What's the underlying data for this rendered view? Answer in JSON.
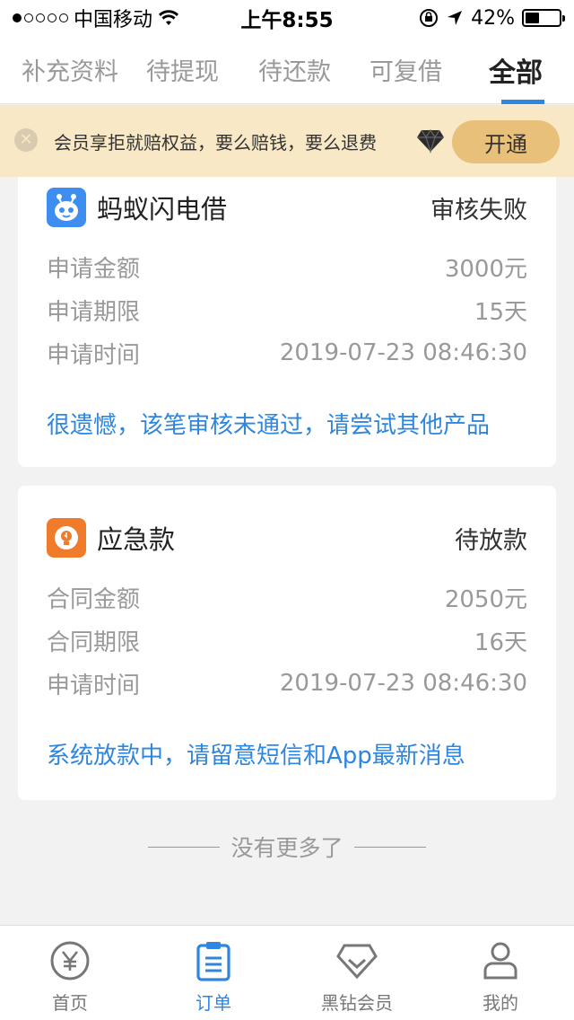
{
  "status_bar": {
    "carrier": "中国移动",
    "time": "上午8:55",
    "battery": "42%",
    "battery_level": 0.42
  },
  "tabs": [
    {
      "label": "补充资料",
      "active": false
    },
    {
      "label": "待提现",
      "active": false
    },
    {
      "label": "待还款",
      "active": false
    },
    {
      "label": "可复借",
      "active": false
    },
    {
      "label": "全部",
      "active": true
    }
  ],
  "banner": {
    "text": "会员享拒就赔权益，要么赔钱，要么退费",
    "button": "开通"
  },
  "orders": [
    {
      "app_name": "蚂蚁闪电借",
      "icon": "ant-robot-icon",
      "icon_color": "#3d8ef0",
      "status": "审核失败",
      "rows": [
        {
          "label": "申请金额",
          "value": "3000元"
        },
        {
          "label": "申请期限",
          "value": "15天"
        },
        {
          "label": "申请时间",
          "value": "2019-07-23 08:46:30"
        }
      ],
      "note": "很遗憾，该笔审核未通过，请尝试其他产品"
    },
    {
      "app_name": "应急款",
      "icon": "lightbulb-icon",
      "icon_color": "#f07b2a",
      "status": "待放款",
      "rows": [
        {
          "label": "合同金额",
          "value": "2050元"
        },
        {
          "label": "合同期限",
          "value": "16天"
        },
        {
          "label": "申请时间",
          "value": "2019-07-23 08:46:30"
        }
      ],
      "note": "系统放款中，请留意短信和App最新消息"
    }
  ],
  "no_more": "没有更多了",
  "bottom_nav": [
    {
      "label": "首页",
      "icon": "yen-icon",
      "active": false
    },
    {
      "label": "订单",
      "icon": "document-icon",
      "active": true
    },
    {
      "label": "黑钻会员",
      "icon": "diamond-icon",
      "active": false
    },
    {
      "label": "我的",
      "icon": "person-icon",
      "active": false
    }
  ],
  "colors": {
    "accent": "#2e86de",
    "banner_bg": "#f8e8c6",
    "banner_button": "#e8c07a"
  }
}
